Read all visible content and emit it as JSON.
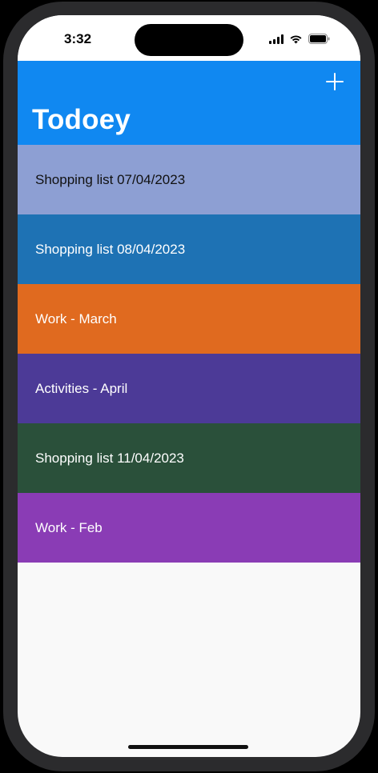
{
  "status_bar": {
    "time": "3:32"
  },
  "nav": {
    "title": "Todoey",
    "add_icon": "plus-icon",
    "color": "#1088f1"
  },
  "categories": [
    {
      "name": "Shopping list 07/04/2023",
      "color": "#8d9fd3",
      "text_color": "#111111"
    },
    {
      "name": "Shopping list 08/04/2023",
      "color": "#1e72b4",
      "text_color": "#ffffff"
    },
    {
      "name": "Work - March",
      "color": "#e06a1f",
      "text_color": "#ffffff"
    },
    {
      "name": "Activities - April",
      "color": "#4c3a97",
      "text_color": "#ffffff"
    },
    {
      "name": "Shopping list 11/04/2023",
      "color": "#2a503a",
      "text_color": "#ffffff"
    },
    {
      "name": "Work - Feb",
      "color": "#8a3cb5",
      "text_color": "#ffffff"
    }
  ]
}
